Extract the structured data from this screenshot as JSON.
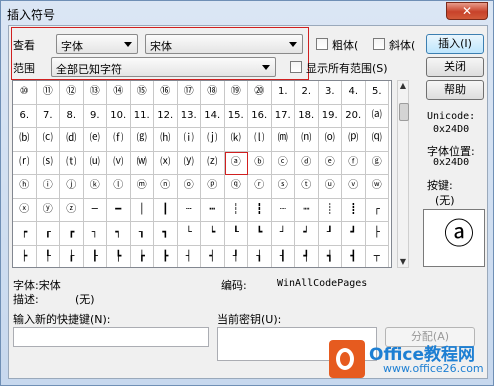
{
  "window": {
    "title": "插入符号",
    "close_glyph": "✕"
  },
  "view": {
    "label": "查看",
    "font_type": "字体",
    "font_name": "宋体"
  },
  "options": {
    "bold_label": "粗体(",
    "italic_label": "斜体("
  },
  "range": {
    "label": "范围",
    "value": "全部已知字符",
    "show_all_label": "显示所有范围(S)"
  },
  "buttons": {
    "insert": "插入(I)",
    "close": "关闭",
    "help": "帮助",
    "assign": "分配(A)"
  },
  "grid": {
    "rows": [
      [
        "⑩",
        "⑪",
        "⑫",
        "⑬",
        "⑭",
        "⑮",
        "⑯",
        "⑰",
        "⑱",
        "⑲",
        "⑳",
        "1.",
        "2.",
        "3.",
        "4.",
        "5."
      ],
      [
        "6.",
        "7.",
        "8.",
        "9.",
        "10.",
        "11.",
        "12.",
        "13.",
        "14.",
        "15.",
        "16.",
        "17.",
        "18.",
        "19.",
        "20.",
        "⒜"
      ],
      [
        "⒝",
        "⒞",
        "⒟",
        "⒠",
        "⒡",
        "⒢",
        "⒣",
        "⒤",
        "⒥",
        "⒦",
        "⒧",
        "⒨",
        "⒩",
        "⒪",
        "⒫",
        "⒬"
      ],
      [
        "⒭",
        "⒮",
        "⒯",
        "⒰",
        "⒱",
        "⒲",
        "⒳",
        "⒴",
        "⒵",
        "ⓐ",
        "ⓑ",
        "ⓒ",
        "ⓓ",
        "ⓔ",
        "ⓕ",
        "ⓖ"
      ],
      [
        "ⓗ",
        "ⓘ",
        "ⓙ",
        "ⓚ",
        "ⓛ",
        "ⓜ",
        "ⓝ",
        "ⓞ",
        "ⓟ",
        "ⓠ",
        "ⓡ",
        "ⓢ",
        "ⓣ",
        "ⓤ",
        "ⓥ",
        "ⓦ"
      ],
      [
        "ⓧ",
        "ⓨ",
        "ⓩ",
        "─",
        "━",
        "│",
        "┃",
        "┄",
        "┅",
        "┆",
        "┇",
        "┈",
        "┉",
        "┊",
        "┋",
        "┌"
      ],
      [
        "┍",
        "┎",
        "┏",
        "┐",
        "┑",
        "┒",
        "┓",
        "└",
        "┕",
        "┖",
        "┗",
        "┘",
        "┙",
        "┚",
        "┛",
        "├"
      ],
      [
        "┝",
        "┞",
        "┟",
        "┠",
        "┡",
        "┢",
        "┣",
        "┤",
        "┥",
        "┦",
        "┧",
        "┨",
        "┩",
        "┪",
        "┫",
        "┬"
      ]
    ],
    "selected_row": 3,
    "selected_col": 9
  },
  "info": {
    "unicode_label": "Unicode:",
    "unicode_value": "0x24D0",
    "font_pos_label": "字体位置:",
    "font_pos_value": "0x24D0",
    "key_label": "按键:",
    "key_value": "(无)",
    "preview_char": "ⓐ"
  },
  "bottom": {
    "font_label": "字体:宋体",
    "code_label": "编码:",
    "code_value": "WinAllCodePages",
    "desc_label": "描述:",
    "desc_value": "(无)",
    "new_shortcut_label": "输入新的快捷键(N):",
    "current_key_label": "当前密钥(U):"
  },
  "watermark": {
    "name": "Office教程网",
    "url": "www.office26.com"
  },
  "colors": {
    "highlight_red": "#d02020",
    "logo_orange": "#e65b1f",
    "logo_blue": "#1d7fd3"
  }
}
